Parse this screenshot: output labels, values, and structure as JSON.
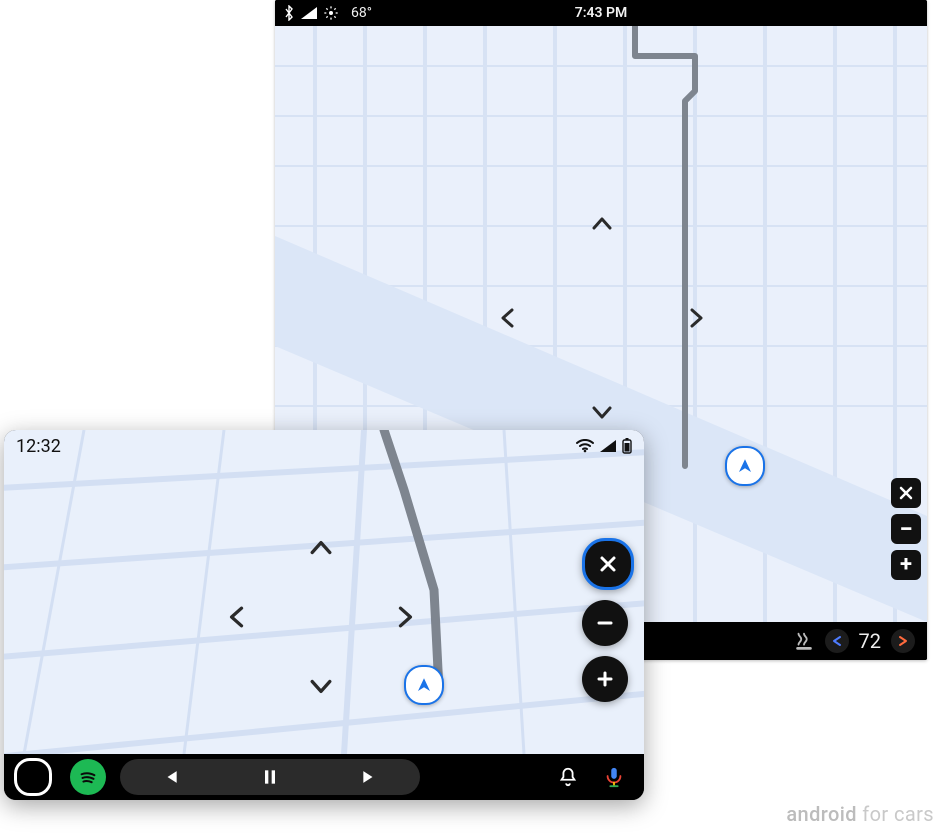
{
  "screenA": {
    "statusbar": {
      "temperature": "68°",
      "time": "7:43 PM"
    },
    "map": {
      "pan": {
        "up": "up",
        "down": "down",
        "left": "left",
        "right": "right"
      },
      "tools": {
        "close": "×",
        "zoom_out": "−",
        "zoom_in": "+"
      }
    },
    "bottombar": {
      "hvac_temp": "72"
    }
  },
  "screenB": {
    "statusbar": {
      "time": "12:32"
    },
    "fabs": {
      "close": "×",
      "zoom_out": "−",
      "zoom_in": "+"
    },
    "media": {
      "prev": "prev",
      "pause": "pause",
      "next": "next"
    }
  },
  "caption": {
    "brand": "android",
    "suffix": " for cars"
  }
}
